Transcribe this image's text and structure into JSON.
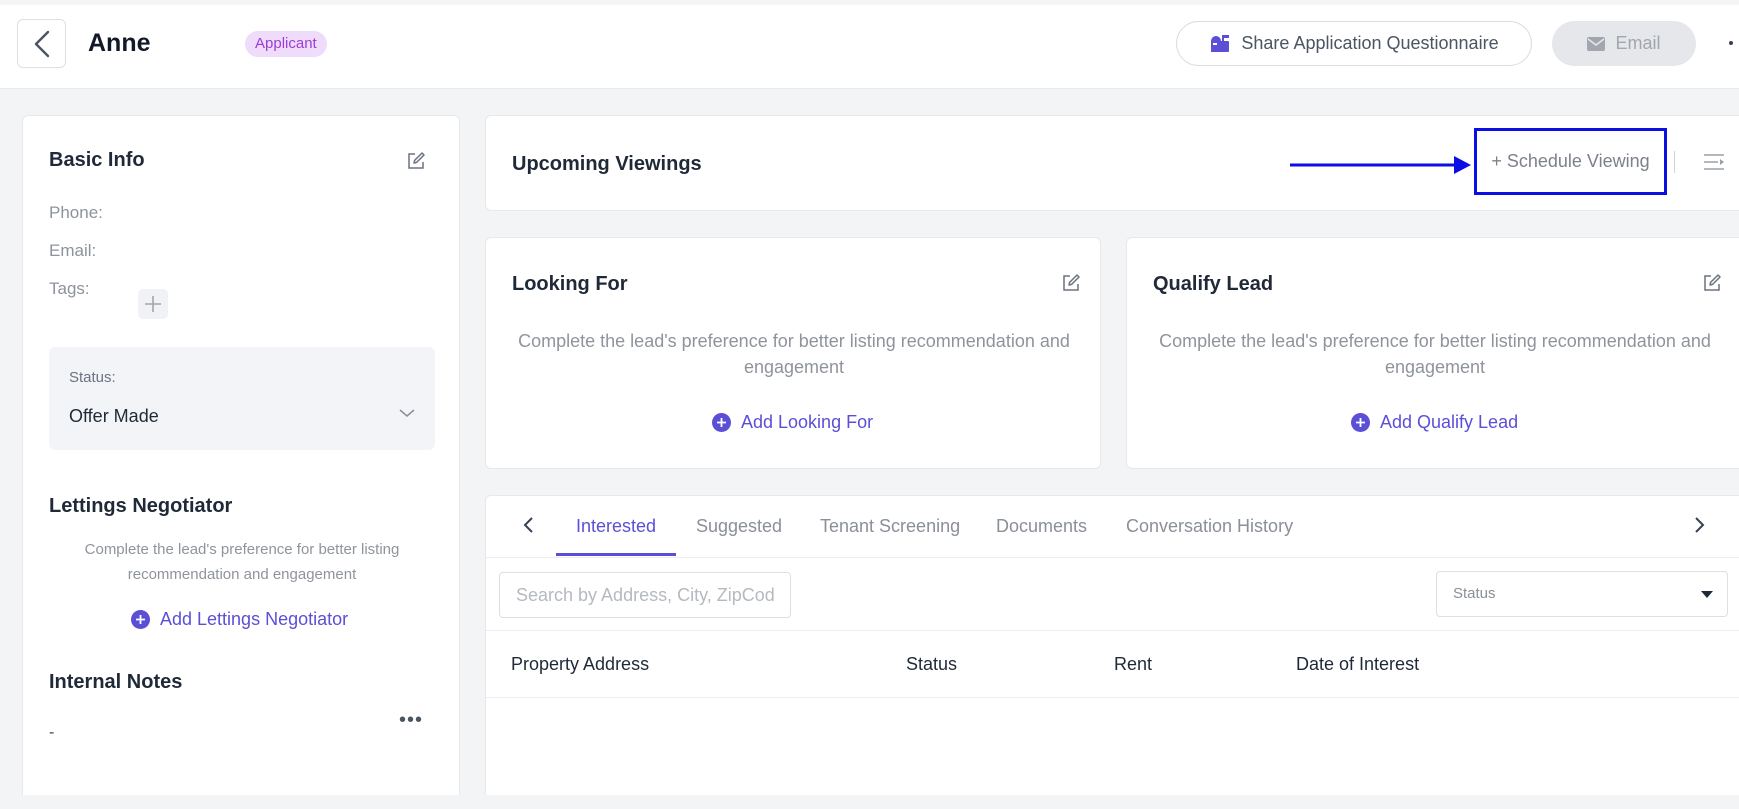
{
  "header": {
    "title": "Anne",
    "badge": "Applicant",
    "share_label": "Share Application Questionnaire",
    "email_label": "Email"
  },
  "basic_info": {
    "title": "Basic Info",
    "phone_label": "Phone:",
    "email_label": "Email:",
    "tags_label": "Tags:",
    "status_label": "Status:",
    "status_value": "Offer Made"
  },
  "negotiator": {
    "title": "Lettings Negotiator",
    "help": "Complete the lead's preference for better listing recommendation and engagement",
    "add_label": "Add Lettings Negotiator"
  },
  "notes": {
    "title": "Internal Notes",
    "value": "-"
  },
  "viewings": {
    "title": "Upcoming Viewings",
    "schedule_label": "+ Schedule Viewing"
  },
  "looking_for": {
    "title": "Looking For",
    "help": "Complete the lead's preference for better listing recommendation and engagement",
    "add_label": "Add Looking For"
  },
  "qualify_lead": {
    "title": "Qualify Lead",
    "help": "Complete the lead's preference for better listing recommendation and engagement",
    "add_label": "Add Qualify Lead"
  },
  "tabs": [
    {
      "label": "Interested",
      "active": true
    },
    {
      "label": "Suggested"
    },
    {
      "label": "Tenant Screening"
    },
    {
      "label": "Documents"
    },
    {
      "label": "Conversation History"
    }
  ],
  "search": {
    "placeholder": "Search by Address, City, ZipCode"
  },
  "filter": {
    "status_label": "Status"
  },
  "table": {
    "columns": [
      "Property Address",
      "Status",
      "Rent",
      "Date of Interest"
    ]
  },
  "colors": {
    "accent": "#5b4fd6",
    "badge_bg": "#efdcfb",
    "badge_text": "#9b3fd4",
    "highlight": "#0d0ee5"
  }
}
